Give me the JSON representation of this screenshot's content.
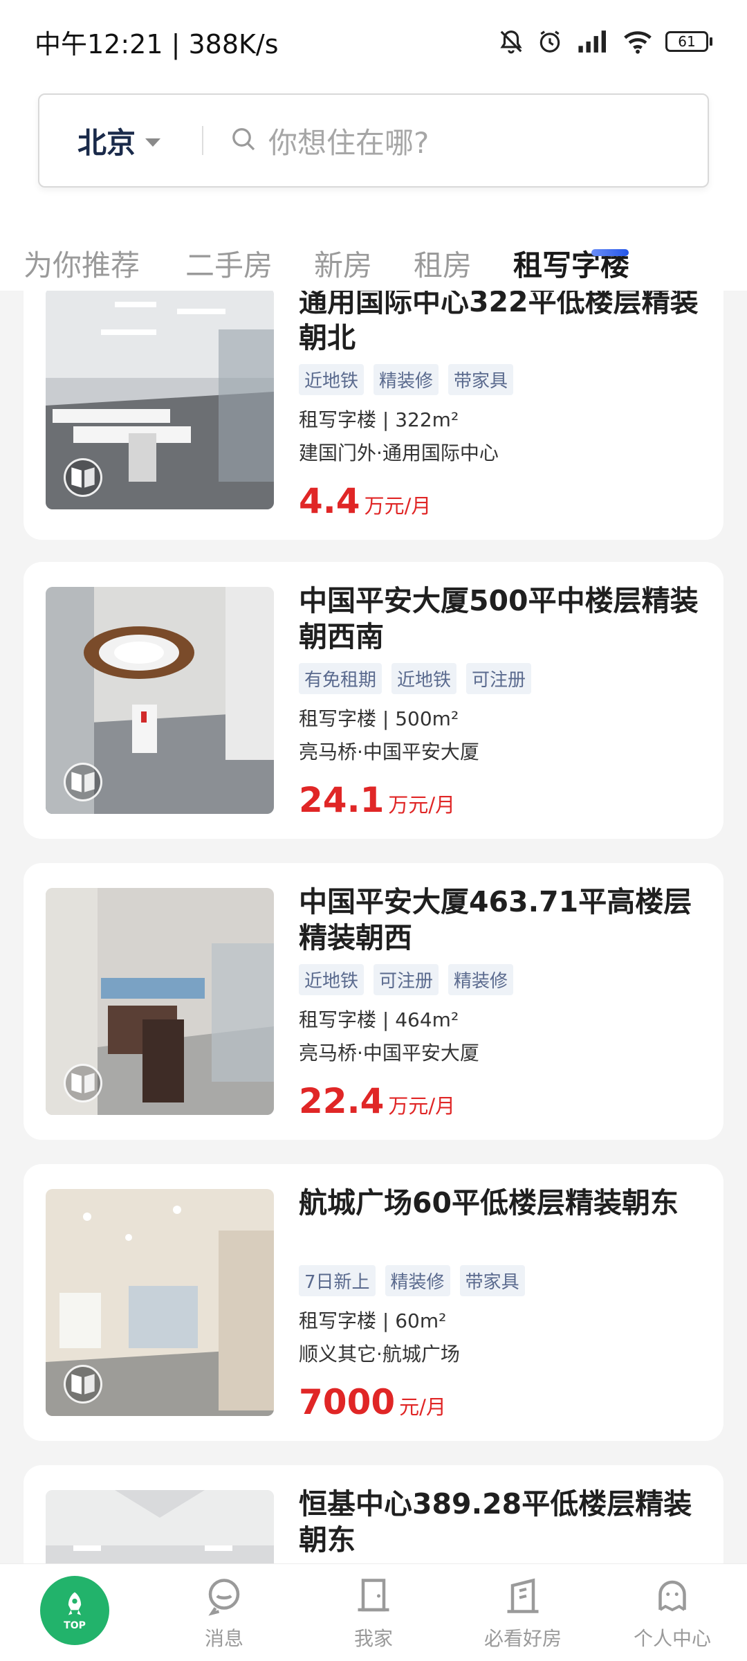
{
  "status_bar": {
    "time_speed": "中午12:21 | 388K/s",
    "battery": "61"
  },
  "search": {
    "city": "北京",
    "placeholder": "你想住在哪?"
  },
  "tabs": [
    {
      "label": "为你推荐"
    },
    {
      "label": "二手房"
    },
    {
      "label": "新房"
    },
    {
      "label": "租房"
    },
    {
      "label": "租写字楼",
      "active": true
    }
  ],
  "listings": [
    {
      "title": "通用国际中心322平低楼层精装朝北",
      "tags": [
        "近地铁",
        "精装修",
        "带家具"
      ],
      "meta": "租写字楼 | 322m²",
      "location": "建国门外·通用国际中心",
      "price": "4.4",
      "price_unit": "万元/月"
    },
    {
      "title": "中国平安大厦500平中楼层精装朝西南",
      "tags": [
        "有免租期",
        "近地铁",
        "可注册"
      ],
      "meta": "租写字楼 | 500m²",
      "location": "亮马桥·中国平安大厦",
      "price": "24.1",
      "price_unit": "万元/月"
    },
    {
      "title": "中国平安大厦463.71平高楼层精装朝西",
      "tags": [
        "近地铁",
        "可注册",
        "精装修"
      ],
      "meta": "租写字楼 | 464m²",
      "location": "亮马桥·中国平安大厦",
      "price": "22.4",
      "price_unit": "万元/月"
    },
    {
      "title": "航城广场60平低楼层精装朝东",
      "tags": [
        "7日新上",
        "精装修",
        "带家具"
      ],
      "meta": "租写字楼 | 60m²",
      "location": "顺义其它·航城广场",
      "price": "7000",
      "price_unit": "元/月"
    },
    {
      "title": "恒基中心389.28平低楼层精装朝东",
      "tags": [],
      "meta": "",
      "location": "",
      "price": "",
      "price_unit": ""
    }
  ],
  "bottom_nav": {
    "top_label": "TOP",
    "items": [
      {
        "label": "消息"
      },
      {
        "label": "我家"
      },
      {
        "label": "必看好房"
      },
      {
        "label": "个人中心"
      }
    ]
  },
  "colors": {
    "price_red": "#e02626",
    "tag_text": "#5a6a8e",
    "top_green": "#22b36b",
    "tab_underline": "#2456e8"
  }
}
